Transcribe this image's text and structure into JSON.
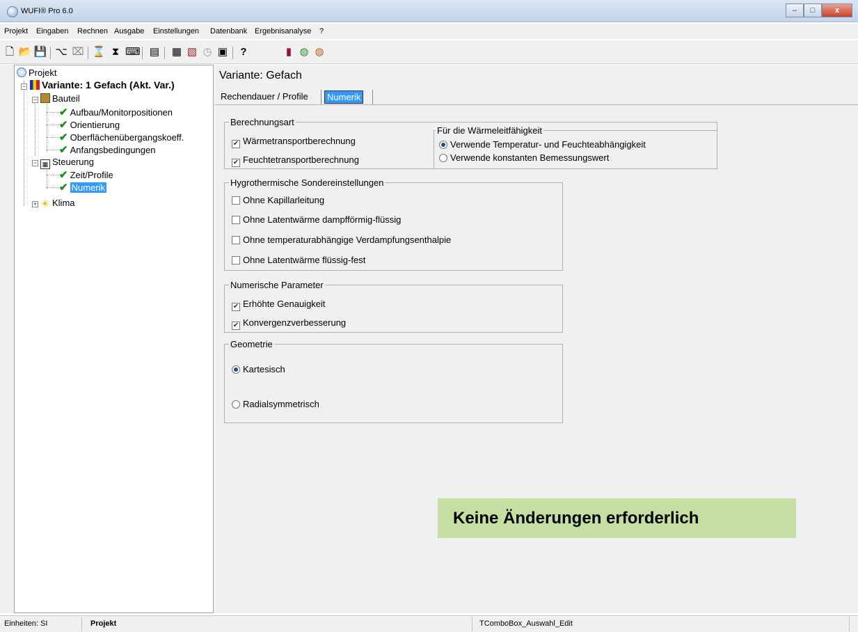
{
  "window": {
    "title": "WUFI® Pro 6.0",
    "minimize": "–",
    "maximize": "□",
    "close": "x"
  },
  "menu": [
    "Projekt",
    "Eingaben",
    "Rechnen",
    "Ausgabe",
    "Einstellungen",
    "Datenbank",
    "Ergebnisanalyse",
    "?"
  ],
  "toolbar": {
    "icons": [
      "new-icon",
      "open-icon",
      "save-icon",
      "tree-icon",
      "tree-remove-icon",
      "hourglass-icon",
      "hourglass-multi-icon",
      "computer-icon",
      "table-icon",
      "grid-icon",
      "chart-icon",
      "clock-icon",
      "monitor-icon",
      "help-icon",
      "book-icon",
      "globe-green-icon",
      "globe-orange-icon"
    ],
    "help_label": "?"
  },
  "tree": {
    "root": "Projekt",
    "variant": "Variante: 1 Gefach (Akt. Var.)",
    "bauteil": "Bauteil",
    "bauteil_children": [
      "Aufbau/Monitorpositionen",
      "Orientierung",
      "Oberflächenübergangskoeff.",
      "Anfangsbedingungen"
    ],
    "steuerung": "Steuerung",
    "steuerung_children": [
      "Zeit/Profile",
      "Numerik"
    ],
    "klima": "Klima"
  },
  "panel": {
    "title": "Variante:  Gefach",
    "tabs": [
      "Rechendauer / Profile",
      "Numerik"
    ],
    "berechnungsart": {
      "legend": "Berechnungsart",
      "options": [
        {
          "label": "Wärmetransportberechnung",
          "checked": true
        },
        {
          "label": "Feuchtetransportberechnung",
          "checked": true
        }
      ]
    },
    "waermeleitfaehigkeit": {
      "legend": "Für die Wärmeleitfähigkeit",
      "options": [
        {
          "label": "Verwende Temperatur- und Feuchteabhängigkeit",
          "selected": true
        },
        {
          "label": "Verwende konstanten Bemessungswert",
          "selected": false
        }
      ]
    },
    "hygro": {
      "legend": "Hygrothermische Sondereinstellungen",
      "options": [
        {
          "label": "Ohne Kapillarleitung",
          "checked": false
        },
        {
          "label": "Ohne Latentwärme dampfförmig-flüssig",
          "checked": false
        },
        {
          "label": "Ohne temperaturabhängige Verdampfungsenthalpie",
          "checked": false
        },
        {
          "label": "Ohne Latentwärme flüssig-fest",
          "checked": false
        }
      ]
    },
    "numerisch": {
      "legend": "Numerische Parameter",
      "options": [
        {
          "label": "Erhöhte Genauigkeit",
          "checked": true
        },
        {
          "label": "Konvergenzverbesserung",
          "checked": true
        }
      ]
    },
    "geometrie": {
      "legend": "Geometrie",
      "options": [
        {
          "label": "Kartesisch",
          "selected": true
        },
        {
          "label": "Radialsymmetrisch",
          "selected": false
        }
      ]
    }
  },
  "banner": "Keine Änderungen erforderlich",
  "status": {
    "units": "Einheiten: SI",
    "context": "Projekt",
    "control": "TComboBox_Auswahl_Edit"
  },
  "colors": {
    "selection": "#3399ff",
    "banner_bg": "#c4dfa1",
    "check_green": "#1a8c1a"
  }
}
